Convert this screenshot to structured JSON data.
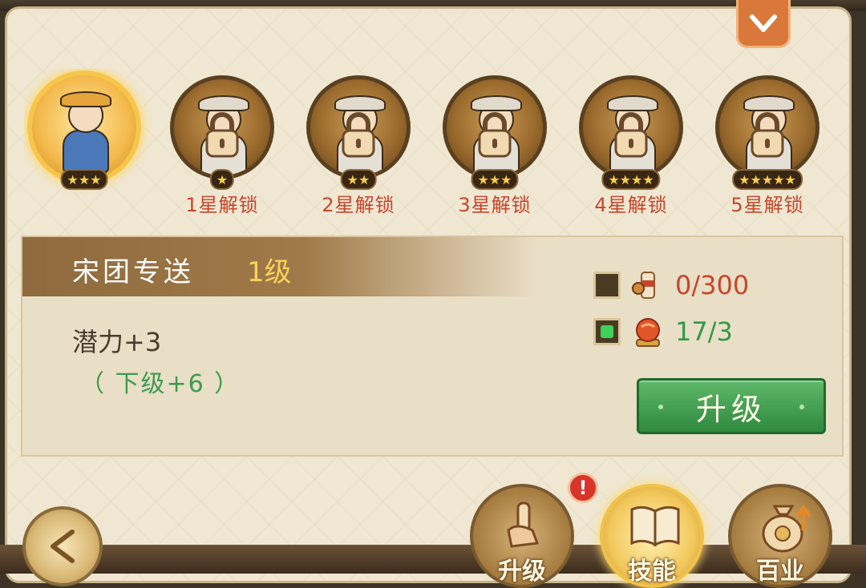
{
  "portraits": [
    {
      "stars": "★★★",
      "unlock": "",
      "locked": false
    },
    {
      "stars": "★",
      "unlock": "1星解锁",
      "locked": true
    },
    {
      "stars": "★★",
      "unlock": "2星解锁",
      "locked": true
    },
    {
      "stars": "★★★",
      "unlock": "3星解锁",
      "locked": true
    },
    {
      "stars": "★★★★",
      "unlock": "4星解锁",
      "locked": true
    },
    {
      "stars": "★★★★★",
      "unlock": "5星解锁",
      "locked": true
    }
  ],
  "skill": {
    "name": "宋团专送",
    "level": "1级",
    "effect": "潜力+3",
    "next_level": "（ 下级+6 ）"
  },
  "requirements": [
    {
      "amount": "0/300",
      "checked": false,
      "icon": "scroll-item-icon"
    },
    {
      "amount": "17/3",
      "checked": true,
      "icon": "orb-item-icon"
    }
  ],
  "upgrade_button": "升级",
  "alert_badge": "!",
  "nav_tabs": [
    {
      "label": "升级",
      "icon": "scroll-hand-icon",
      "selected": false
    },
    {
      "label": "技能",
      "icon": "book-icon",
      "selected": true
    },
    {
      "label": "百业",
      "icon": "money-bag-icon",
      "selected": false
    }
  ],
  "colors": {
    "accent_red": "#c8452c",
    "accent_green": "#2f9a48",
    "gold": "#f7d25c"
  }
}
